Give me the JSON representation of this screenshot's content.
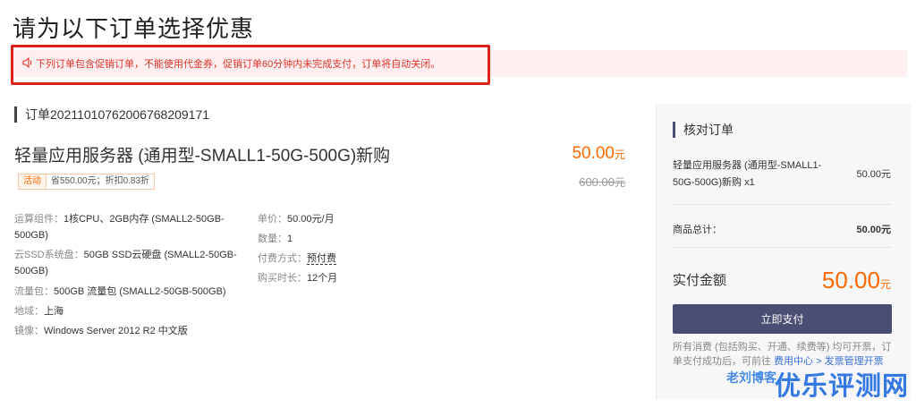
{
  "page": {
    "title": "请为以下订单选择优惠"
  },
  "notice": {
    "text": "下列订单包含促销订单，不能使用代金券，促销订单60分钟内未完成支付，订单将自动关闭。",
    "icon": "speaker-icon",
    "highlight_color": "#e0201b"
  },
  "order": {
    "heading": "订单20211010762006768209171",
    "product_name": "轻量应用服务器 (通用型-SMALL1-50G-500G)新购",
    "price": "50.00",
    "price_unit": "元",
    "original_price": "600.00",
    "original_price_unit": "元",
    "promo_tag": "活动",
    "promo_text": "省550.00元；折扣0.83折",
    "specs_left": [
      {
        "key": "运算组件：",
        "value": "1核CPU、2GB内存 (SMALL2-50GB-500GB)"
      },
      {
        "key": "云SSD系统盘：",
        "value": "50GB SSD云硬盘 (SMALL2-50GB-500GB)"
      },
      {
        "key": "流量包：",
        "value": "500GB 流量包 (SMALL2-50GB-500GB)"
      },
      {
        "key": "地域：",
        "value": "上海"
      },
      {
        "key": "镜像：",
        "value": "Windows Server 2012 R2 中文版"
      }
    ],
    "specs_right": [
      {
        "key": "单价：",
        "value": "50.00元/月"
      },
      {
        "key": "数量：",
        "value": "1"
      },
      {
        "key": "付费方式：",
        "value": "预付费"
      },
      {
        "key": "购买时长：",
        "value": "12个月"
      }
    ]
  },
  "summary": {
    "title": "核对订单",
    "item_name": "轻量应用服务器 (通用型-SMALL1-50G-500G)新购 x1",
    "item_price": "50.00元",
    "total_label": "商品总计：",
    "total_value": "50.00元",
    "pay_label": "实付金额",
    "pay_value": "50.00",
    "pay_unit": "元",
    "pay_button": "立即支付",
    "note_prefix": "所有消费 (包括购买、开通、续费等) 均可开票，订单支付成功后，可前往 ",
    "note_link": "费用中心 > 发票管理开票",
    "accent_color": "#4a4e73",
    "price_color": "#ff6a00"
  },
  "watermark": {
    "left": "老刘博客",
    "right": "优乐评测网"
  }
}
